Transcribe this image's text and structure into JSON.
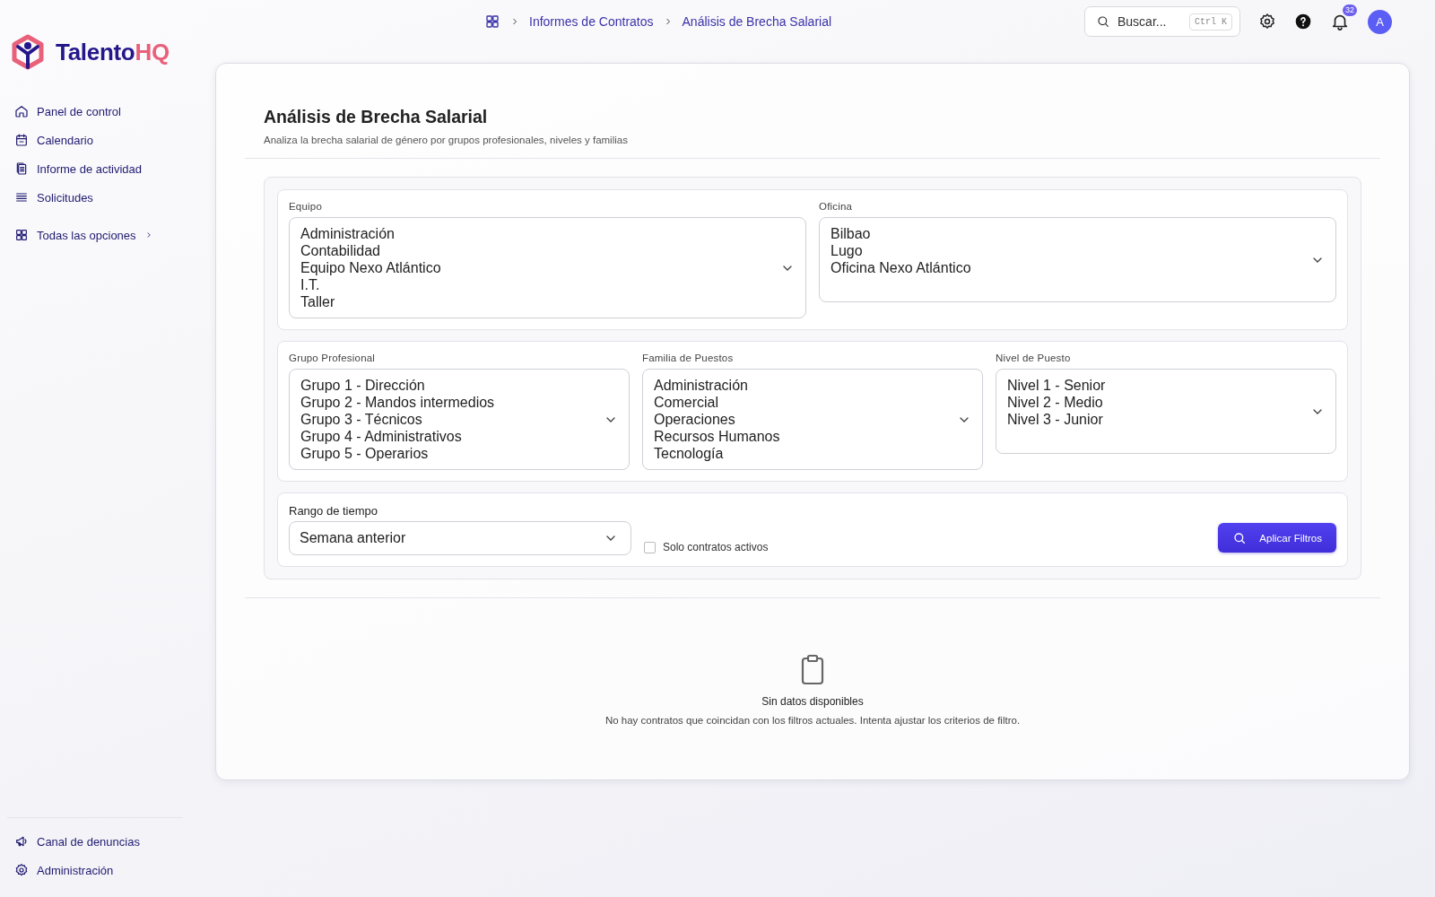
{
  "brand": {
    "name": "Talento",
    "accent": "HQ"
  },
  "sidebar": {
    "items": [
      {
        "label": "Panel de control"
      },
      {
        "label": "Calendario"
      },
      {
        "label": "Informe de actividad"
      },
      {
        "label": "Solicitudes"
      }
    ],
    "all_options": "Todas las opciones",
    "footer_items": [
      {
        "label": "Canal de denuncias"
      },
      {
        "label": "Administración"
      }
    ]
  },
  "breadcrumb": [
    "Informes de Contratos",
    "Análisis de Brecha Salarial"
  ],
  "search": {
    "placeholder": "Buscar...",
    "shortcut": "Ctrl K"
  },
  "notifications": {
    "count": "32"
  },
  "avatar": "A",
  "page": {
    "title": "Análisis de Brecha Salarial",
    "subtitle": "Analiza la brecha salarial de género por grupos profesionales, niveles y familias"
  },
  "filter_rows": [
    [
      {
        "label": "Equipo",
        "options": [
          {
            "text": "Administración",
            "selected": false
          },
          {
            "text": "Contabilidad",
            "selected": false
          },
          {
            "text": "Equipo Nexo Atlántico",
            "selected": false
          },
          {
            "text": "I.T.",
            "selected": false
          },
          {
            "text": "Taller",
            "selected": false
          }
        ]
      },
      {
        "label": "Oficina",
        "options": [
          {
            "text": "Bilbao",
            "selected": false
          },
          {
            "text": "Lugo",
            "selected": false
          },
          {
            "text": "Oficina Nexo Atlántico",
            "selected": false
          }
        ]
      }
    ],
    [
      {
        "label": "Grupo Profesional",
        "options": [
          {
            "text": "Grupo 1 - Dirección",
            "selected": false
          },
          {
            "text": "Grupo 2 - Mandos intermedios",
            "selected": false
          },
          {
            "text": "Grupo 3 - Técnicos",
            "selected": false
          },
          {
            "text": "Grupo 4 - Administrativos",
            "selected": false
          },
          {
            "text": "Grupo 5 - Operarios",
            "selected": false
          }
        ]
      },
      {
        "label": "Familia de Puestos",
        "options": [
          {
            "text": "Administración",
            "selected": false
          },
          {
            "text": "Comercial",
            "selected": false
          },
          {
            "text": "Operaciones",
            "selected": false
          },
          {
            "text": "Recursos Humanos",
            "selected": false
          },
          {
            "text": "Tecnología",
            "selected": false
          }
        ]
      },
      {
        "label": "Nivel de Puesto",
        "options": [
          {
            "text": "Nivel 1 - Senior",
            "selected": false
          },
          {
            "text": "Nivel 2 - Medio",
            "selected": false
          },
          {
            "text": "Nivel 3 - Junior",
            "selected": false
          }
        ]
      }
    ]
  ],
  "time_range": {
    "label": "Rango de tiempo",
    "value": "Semana anterior"
  },
  "active_only": {
    "label": "Solo contratos activos",
    "checked": false
  },
  "apply_button": "Aplicar Filtros",
  "empty_state": {
    "title": "Sin datos disponibles",
    "message": "No hay contratos que coincidan con los filtros actuales. Intenta ajustar los criterios de filtro."
  }
}
